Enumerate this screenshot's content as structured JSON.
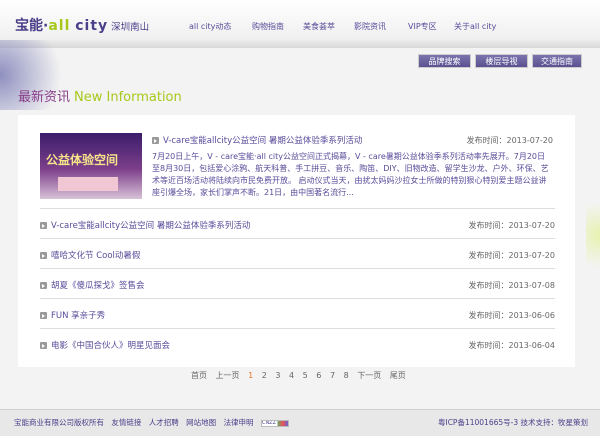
{
  "header": {
    "logo_brand": "宝能·",
    "logo_all": "all",
    "logo_city": "city",
    "logo_location": "深圳南山",
    "nav": [
      "all city动态",
      "购物指南",
      "美食荟萃",
      "影院资讯",
      "VIP专区",
      "关于all city"
    ]
  },
  "tools": [
    "品牌搜索",
    "楼层导视",
    "交通指南"
  ],
  "section": {
    "title_cn": "最新资讯",
    "title_en": "New Information"
  },
  "featured": {
    "image_text": "公益体验空间",
    "title": "V-care宝能allcity公益空间 暑期公益体验季系列活动",
    "date": "发布时间：2013-07-20",
    "summary": "7月20日上午，V - care宝能·all city公益空间正式揭幕，V - care暑期公益体验季系列活动率先展开。7月20日至8月30日，包括爱心涂鸦、航天科普、手工拼豆、音乐、陶笛、DIY、旧物改造、留学生沙龙、户外、环保、艺术等近百场活动将陆续向市民免费开放。 启动仪式当天，由扰太妈妈沙拉女士所做的特别狠心特别爱主题公益讲座引爆全场，家长们掌声不断。21日，由中国著名流行..."
  },
  "news": [
    {
      "title": "V-care宝能allcity公益空间 暑期公益体验季系列活动",
      "date": "发布时间：2013-07-20"
    },
    {
      "title": "嘻哈文化节 Cool动暑假",
      "date": "发布时间：2013-07-20"
    },
    {
      "title": "胡夏《傻瓜探戈》签售会",
      "date": "发布时间：2013-07-08"
    },
    {
      "title": "FUN 享亲子秀",
      "date": "发布时间：2013-06-06"
    },
    {
      "title": "电影《中国合伙人》明星见面会",
      "date": "发布时间：2013-06-04"
    }
  ],
  "pager": {
    "first": "首页",
    "prev": "上一页",
    "pages": [
      "1",
      "2",
      "3",
      "4",
      "5",
      "6",
      "7",
      "8"
    ],
    "current": "1",
    "next": "下一页",
    "last": "尾页"
  },
  "footer": {
    "links": [
      "宝能商业有限公司版权所有",
      "友情链接",
      "人才招聘",
      "网站地图",
      "法律申明"
    ],
    "cnzz": "CNZZ",
    "right": "粤ICP备11001665号-3 技术支持：牧星策划"
  }
}
